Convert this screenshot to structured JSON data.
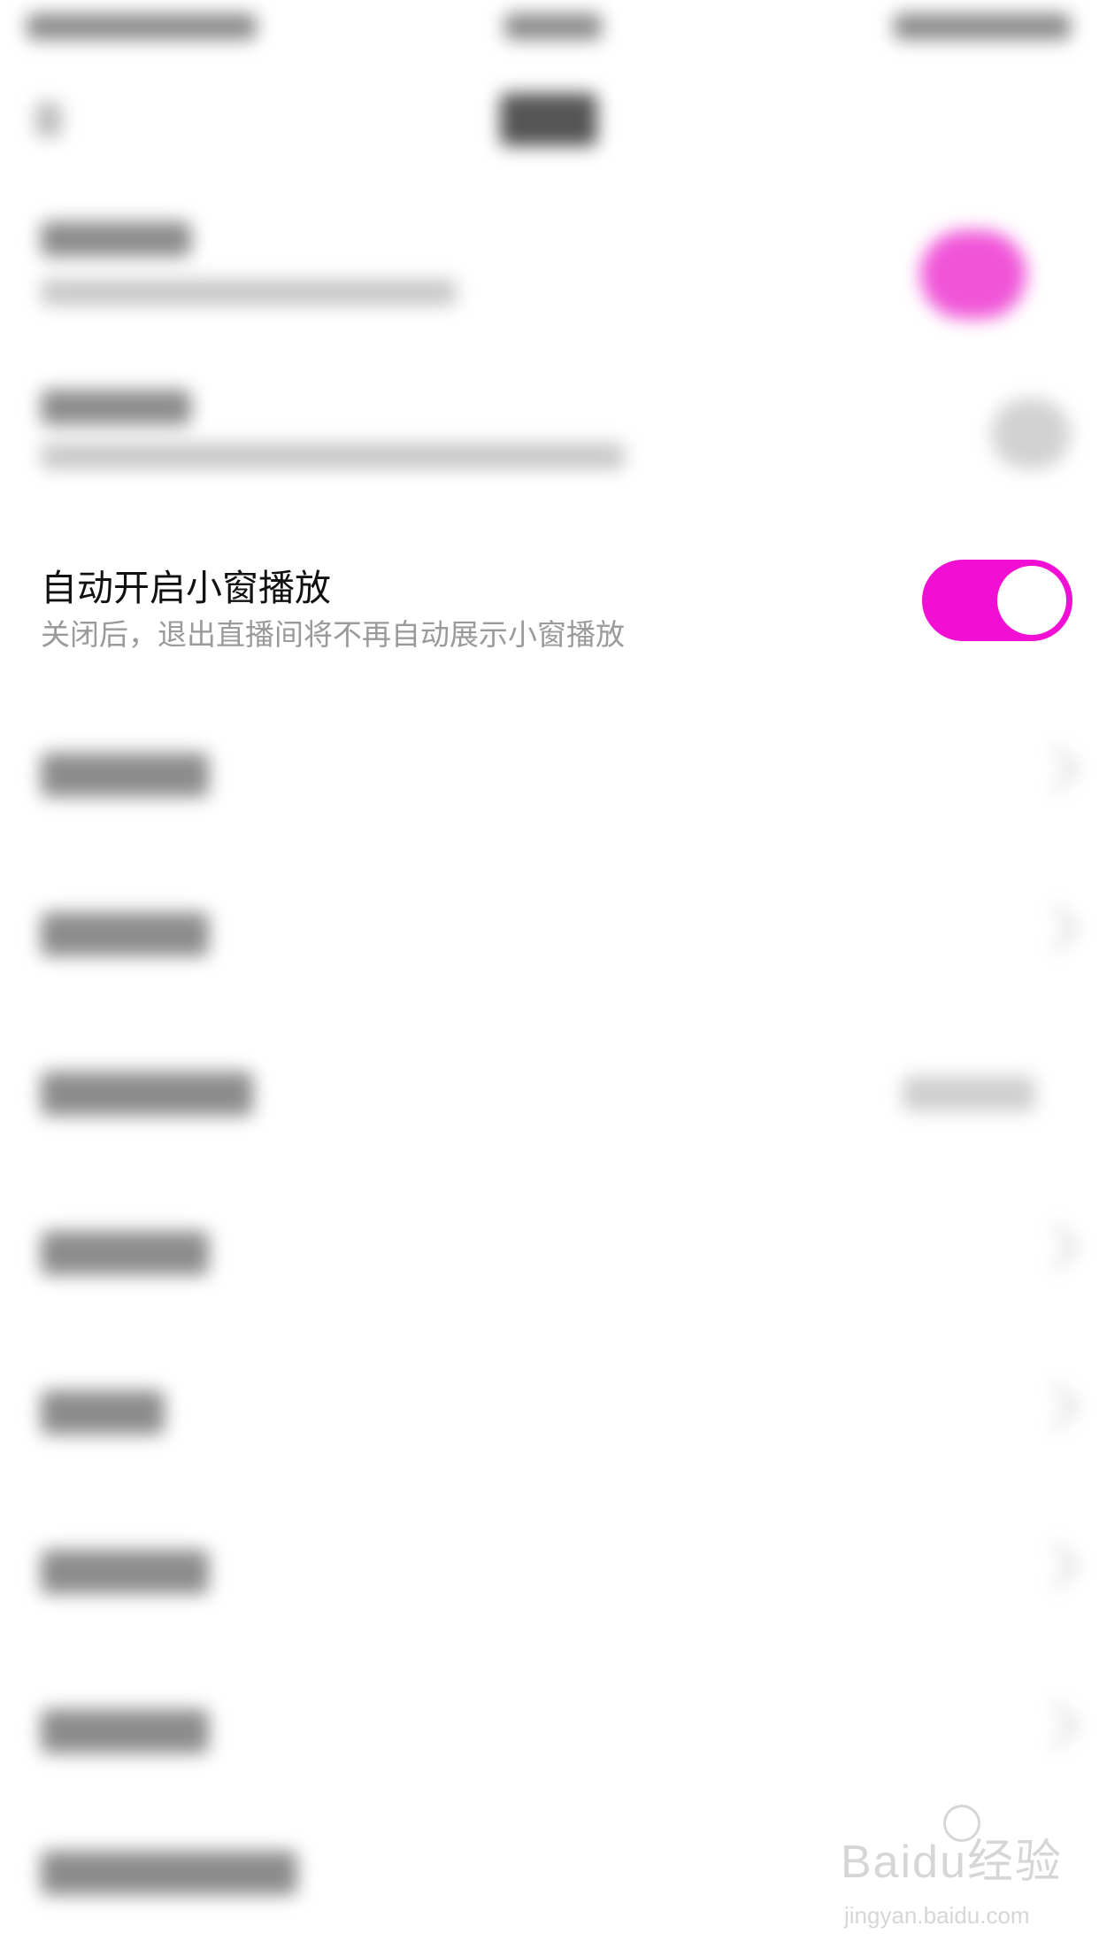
{
  "setting": {
    "title": "自动开启小窗播放",
    "description": "关闭后，退出直播间将不再自动展示小窗播放",
    "enabled": true
  },
  "colors": {
    "accent": "#f20fd4",
    "title_text": "#111111",
    "description_text": "#9a9a9a",
    "background": "#ffffff"
  },
  "watermark": {
    "logo": "Baidu经验",
    "url": "jingyan.baidu.com"
  }
}
